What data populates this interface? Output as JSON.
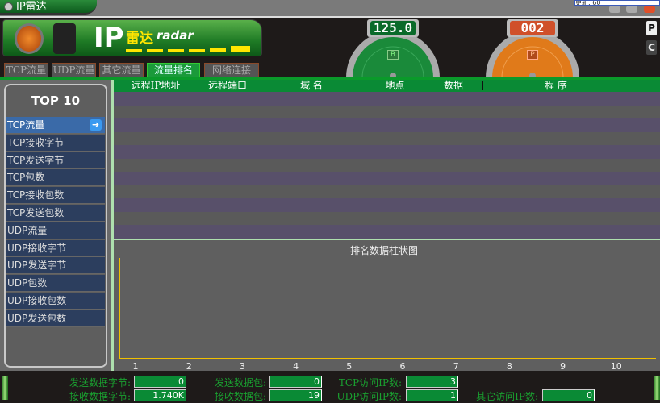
{
  "app": {
    "title": "IP雷达",
    "tooltip": "更新: 60"
  },
  "logo": {
    "ip": "IP",
    "cn": "雷达",
    "en": "radar"
  },
  "tabs": [
    {
      "label": "TCP流量"
    },
    {
      "label": "UDP流量"
    },
    {
      "label": "其它流量"
    },
    {
      "label": "流量排名",
      "active": true
    },
    {
      "label": "网络连接"
    }
  ],
  "gauges": [
    {
      "value": "125.0",
      "letter": "B",
      "color": "#1a8a3a"
    },
    {
      "value": "002",
      "letter": "P",
      "color": "#e06a1a"
    }
  ],
  "side_buttons": [
    "P",
    "C"
  ],
  "top10": {
    "title": "TOP 10",
    "items": [
      "TCP流量",
      "TCP接收字节",
      "TCP发送字节",
      "TCP包数",
      "TCP接收包数",
      "TCP发送包数",
      "UDP流量",
      "UDP接收字节",
      "UDP发送字节",
      "UDP包数",
      "UDP接收包数",
      "UDP发送包数"
    ]
  },
  "table": {
    "columns": [
      "远程IP地址",
      "远程端口",
      "域 名",
      "地点",
      "数据",
      "程 序"
    ],
    "rows": []
  },
  "chart_data": {
    "type": "bar",
    "title": "排名数据柱状图",
    "categories": [
      "1",
      "2",
      "3",
      "4",
      "5",
      "6",
      "7",
      "8",
      "9",
      "10"
    ],
    "values": []
  },
  "status": {
    "send_bytes_label": "发送数据字节:",
    "send_bytes": "0",
    "send_packets_label": "发送数据包:",
    "send_packets": "0",
    "tcp_ip_label": "TCP访问IP数:",
    "tcp_ip": "3",
    "recv_bytes_label": "接收数据字节:",
    "recv_bytes": "1.740K",
    "recv_packets_label": "接收数据包:",
    "recv_packets": "19",
    "udp_ip_label": "UDP访问IP数:",
    "udp_ip": "1",
    "other_ip_label": "其它访问IP数:",
    "other_ip": "0"
  }
}
